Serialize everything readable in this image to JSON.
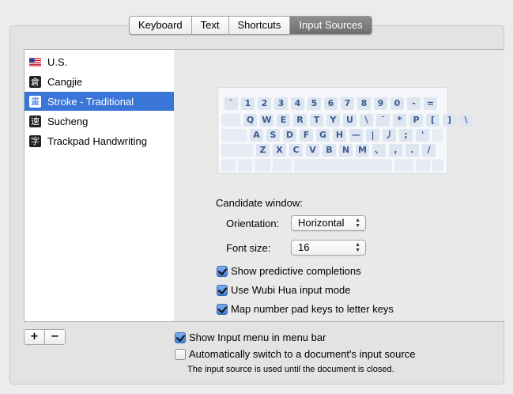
{
  "tabs": [
    "Keyboard",
    "Text",
    "Shortcuts",
    "Input Sources"
  ],
  "selected_tab": "Input Sources",
  "input_sources": [
    {
      "label": "U.S.",
      "icon": "us-flag-icon",
      "glyph": ""
    },
    {
      "label": "Cangjie",
      "icon": "cangjie-icon",
      "glyph": "倉"
    },
    {
      "label": "Stroke - Traditional",
      "icon": "stroke-icon",
      "glyph": "畫",
      "selected": true
    },
    {
      "label": "Sucheng",
      "icon": "sucheng-icon",
      "glyph": "速"
    },
    {
      "label": "Trackpad Handwriting",
      "icon": "handwriting-icon",
      "glyph": "字"
    }
  ],
  "keyboard_rows": [
    [
      "`",
      "1",
      "2",
      "3",
      "4",
      "5",
      "6",
      "7",
      "8",
      "9",
      "0",
      "-",
      "="
    ],
    [
      "Q",
      "W",
      "E",
      "R",
      "T",
      "Y",
      "U",
      "\\",
      "¯",
      "*",
      "P",
      "[",
      "]",
      "\\"
    ],
    [
      "A",
      "S",
      "D",
      "F",
      "G",
      "H",
      "—",
      "|",
      "丿",
      ";",
      "'"
    ],
    [
      "Z",
      "X",
      "C",
      "V",
      "B",
      "N",
      "M",
      "、",
      ",",
      ".",
      "/"
    ]
  ],
  "candidate_window": {
    "heading": "Candidate window:",
    "orientation_label": "Orientation:",
    "orientation_value": "Horizontal",
    "font_size_label": "Font size:",
    "font_size_value": "16"
  },
  "options": {
    "show_predictive": {
      "label": "Show predictive completions",
      "checked": true
    },
    "use_wubi_hua": {
      "label": "Use Wubi Hua input mode",
      "checked": true
    },
    "map_number_pad": {
      "label": "Map number pad keys to letter keys",
      "checked": true
    }
  },
  "footer": {
    "add_label": "+",
    "remove_label": "−",
    "show_input_menu": {
      "label": "Show Input menu in menu bar",
      "checked": true
    },
    "auto_switch": {
      "label": "Automatically switch to a document's input source",
      "checked": false
    },
    "note": "The input source is used until the document is closed."
  },
  "colors": {
    "selection": "#3a76d7",
    "key_text": "#3d5b8f",
    "key_fill": "#dde5f1"
  }
}
